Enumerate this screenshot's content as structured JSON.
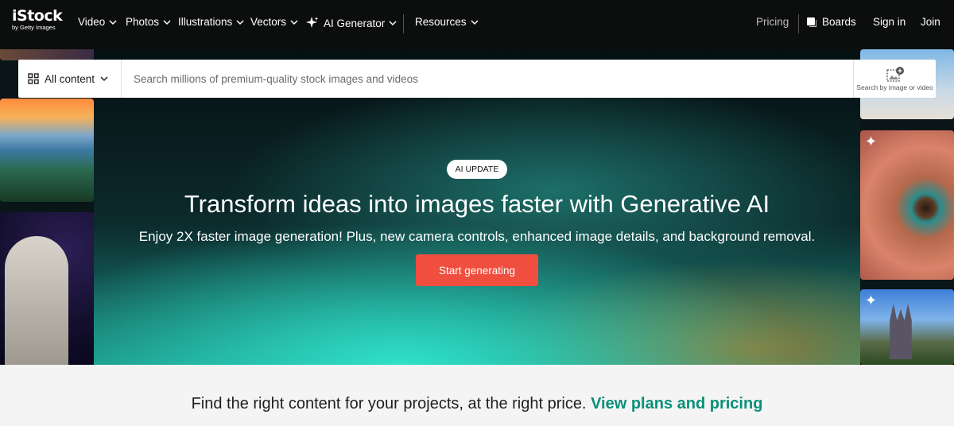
{
  "logo": {
    "main": "iStock",
    "sub": "by Getty Images"
  },
  "nav": {
    "items": [
      "Video",
      "Photos",
      "Illustrations",
      "Vectors",
      "AI Generator",
      "Resources"
    ],
    "pricing": "Pricing",
    "boards": "Boards",
    "sign_in": "Sign in",
    "join": "Join"
  },
  "search": {
    "filter_label": "All content",
    "placeholder": "Search millions of premium-quality stock images and videos",
    "visual_search_label": "Search by image or video"
  },
  "hero": {
    "badge": "AI UPDATE",
    "headline": "Transform ideas into images faster with Generative AI",
    "subline": "Enjoy 2X faster image generation! Plus, new camera controls, enhanced image details, and background removal.",
    "cta": "Start generating"
  },
  "promo": {
    "text": "Find the right content for your projects, at the right price.",
    "link": "View plans and pricing"
  },
  "colors": {
    "nav_bg": "#0c0d0d",
    "cta": "#f04e3e",
    "link": "#089079"
  }
}
